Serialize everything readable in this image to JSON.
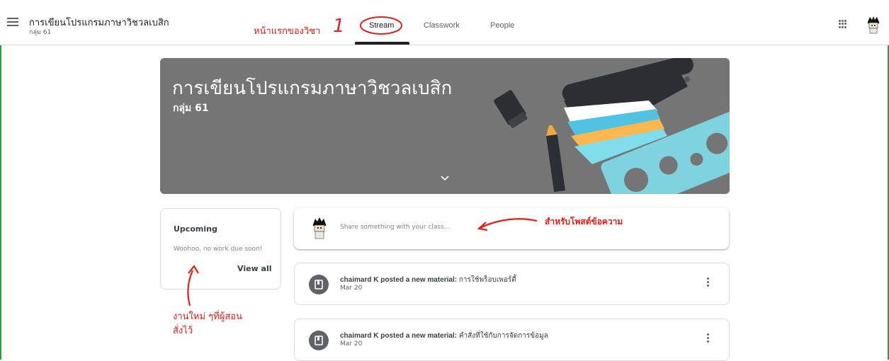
{
  "header": {
    "class_title": "การเขียนโปรแกรมภาษาวิชวลเบสิก",
    "class_section": "กลุ่ม 61",
    "tabs": [
      {
        "label": "Stream",
        "active": true
      },
      {
        "label": "Classwork",
        "active": false
      },
      {
        "label": "People",
        "active": false
      }
    ],
    "icons": [
      "menu-icon",
      "apps-icon",
      "avatar"
    ]
  },
  "annotations": {
    "home_label": "หน้าแรกของวิชา",
    "number": "1",
    "post_hint": "สำหรับโพสต์ข้อความ",
    "upcoming_hint_line1": "งานใหม่ ๆที่ผู้สอน",
    "upcoming_hint_line2": "สั่งไว้"
  },
  "banner": {
    "title": "การเขียนโปรแกรมภาษาวิชวลเบสิก",
    "subtitle": "กลุ่ม 61",
    "background": "#757575"
  },
  "upcoming": {
    "title": "Upcoming",
    "text": "Woohoo, no work due soon!",
    "view_all": "View all"
  },
  "share": {
    "placeholder": "Share something with your class..."
  },
  "posts": [
    {
      "author_action": "chaimard K posted a new material:",
      "topic": "การใช้พร็อบเพอร์ตี้",
      "date": "Mar 20"
    },
    {
      "author_action": "chaimard K posted a new material:",
      "topic": "คำสั่งที่ใช้กับการจัดการข้อมูล",
      "date": "Mar 20"
    }
  ],
  "colors": {
    "annotation": "#e0201a",
    "frame": "#2e9e44",
    "text": "#3c4043"
  }
}
